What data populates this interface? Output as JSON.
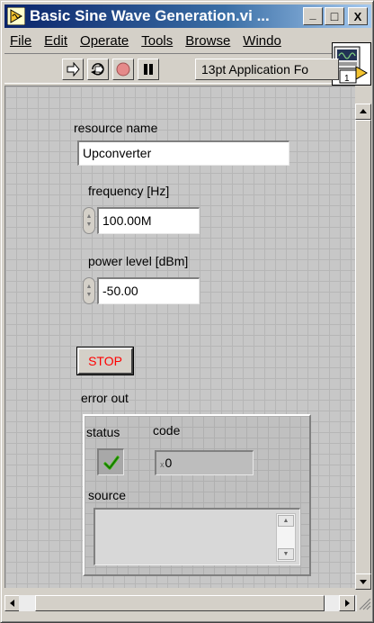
{
  "window": {
    "title": "Basic Sine Wave Generation.vi ...",
    "minimize_label": "_",
    "maximize_label": "□",
    "close_label": "X"
  },
  "menu": {
    "items": [
      {
        "label": "File"
      },
      {
        "label": "Edit"
      },
      {
        "label": "Operate"
      },
      {
        "label": "Tools"
      },
      {
        "label": "Browse"
      },
      {
        "label": "Windo"
      }
    ]
  },
  "toolbar": {
    "font_ring_text": "13pt Application Fo"
  },
  "connector": {
    "label": "1"
  },
  "controls": {
    "resource_name": {
      "label": "resource name",
      "value": "Upconverter"
    },
    "frequency": {
      "label": "frequency [Hz]",
      "value": "100.00M"
    },
    "power_level": {
      "label": "power level [dBm]",
      "value": "-50.00"
    },
    "stop_button": {
      "label": "STOP"
    }
  },
  "error_out": {
    "label": "error out",
    "status_label": "status",
    "code_label": "code",
    "code_radix": "x",
    "code_value": "0",
    "source_label": "source",
    "source_value": ""
  },
  "colors": {
    "stop_text": "#ff0000",
    "status_ok": "#2fae00",
    "titlebar_start": "#0a246a",
    "titlebar_end": "#a6caf0"
  },
  "icons": [
    "run-arrow-icon",
    "run-continuously-icon",
    "abort-icon",
    "pause-icon",
    "labview-vi-icon",
    "connector-pane-icon"
  ]
}
